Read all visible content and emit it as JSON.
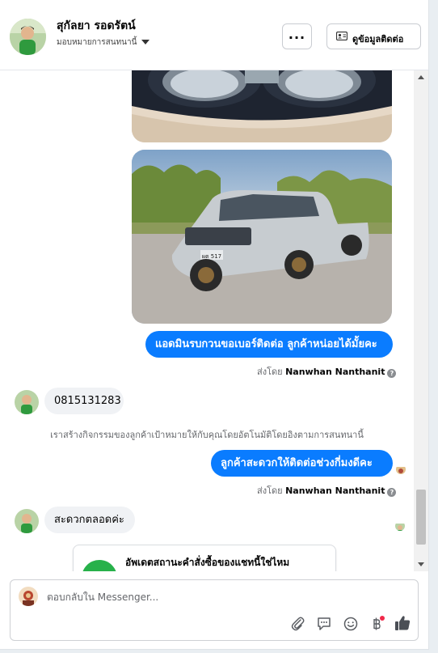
{
  "header": {
    "name": "สุกัลยา รอดรัตน์",
    "assignment": "มอบหมายการสนทนานี้",
    "more_label": "...",
    "contact_button_label": "ดูข้อมูลติดต่อ"
  },
  "messages": {
    "out_1": "แอดมินรบกวนขอเบอร์ติดต่อ ลูกค้าหน่อยได้มั้ยคะ",
    "sent_by_prefix": "ส่งโดย",
    "sent_by_name_1": "Nanwhan Nanthanit",
    "in_1": "0815131283",
    "system_note": "เราสร้างกิจกรรมของลูกค้าเป้าหมายให้กับคุณโดยอัตโนมัติโดยอิงตามการสนทนานี้",
    "out_2": "ลูกค้าสะดวกให้ติดต่อช่วงกี่มงดีคะ",
    "sent_by_name_2": "Nanwhan Nanthanit",
    "in_2": "สะดวกตลอดค่ะ",
    "card_title": "อัพเดตสถานะคำสั่งซื้อของแชทนี้ใช่ไหม",
    "plate_text": "ผต 517"
  },
  "composer": {
    "placeholder": "ตอบกลับใน Messenger..."
  },
  "colors": {
    "accent": "#0a7cff",
    "incoming_bubble": "#f0f2f5",
    "notification_dot": "#f02849",
    "card_icon": "#27b14a"
  },
  "icons": {
    "attach": "paperclip-icon",
    "saved_replies": "chat-bubble-icon",
    "emoji": "smiley-icon",
    "payment": "baht-icon",
    "like": "thumbs-up-icon"
  }
}
